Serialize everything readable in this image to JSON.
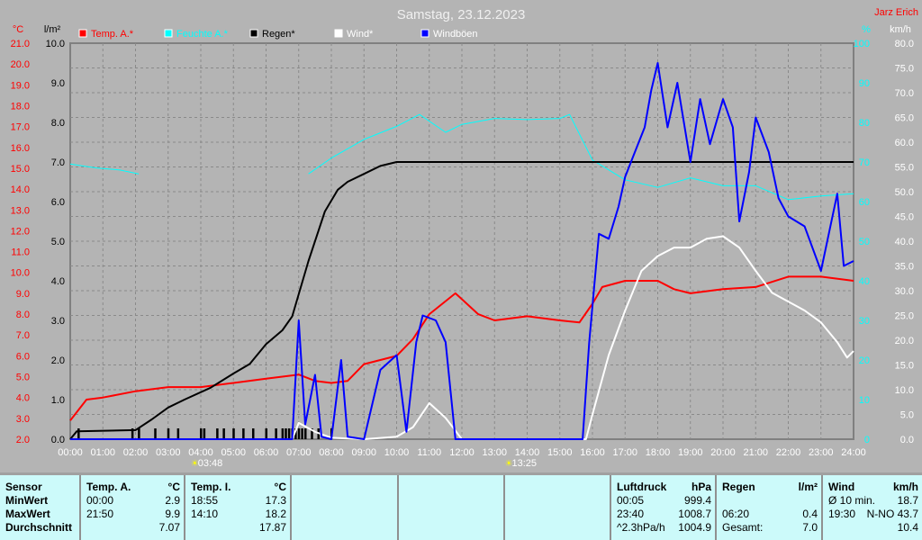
{
  "title": "Samstag, 23.12.2023",
  "author": "Jarz Erich",
  "units": {
    "temp": "°C",
    "rain": "l/m²",
    "hum": "%",
    "wind": "km/h"
  },
  "chart_data": {
    "type": "line",
    "title": "Samstag, 23.12.2023",
    "x_ticks": [
      "00:00",
      "01:00",
      "02:00",
      "03:00",
      "04:00",
      "05:00",
      "06:00",
      "07:00",
      "08:00",
      "09:00",
      "10:00",
      "11:00",
      "12:00",
      "13:00",
      "14:00",
      "15:00",
      "16:00",
      "17:00",
      "18:00",
      "19:00",
      "20:00",
      "21:00",
      "22:00",
      "23:00",
      "24:00"
    ],
    "axes": {
      "temp": {
        "label": "°C",
        "range": [
          2,
          21
        ],
        "ticks": [
          "21.0",
          "20.0",
          "19.0",
          "18.0",
          "17.0",
          "16.0",
          "15.0",
          "14.0",
          "13.0",
          "12.0",
          "11.0",
          "10.0",
          "9.0",
          "8.0",
          "7.0",
          "6.0",
          "5.0",
          "4.0",
          "3.0",
          "2.0"
        ],
        "color": "#ff0000"
      },
      "rain": {
        "label": "l/m²",
        "range": [
          0,
          10
        ],
        "ticks": [
          "10.0",
          "9.0",
          "8.0",
          "7.0",
          "6.0",
          "5.0",
          "4.0",
          "3.0",
          "2.0",
          "1.0",
          "0.0"
        ],
        "color": "#000000"
      },
      "hum": {
        "label": "%",
        "range": [
          0,
          100
        ],
        "ticks": [
          "100",
          "90",
          "80",
          "70",
          "60",
          "50",
          "40",
          "30",
          "20",
          "10",
          "0"
        ],
        "color": "#00ffff"
      },
      "wind": {
        "label": "km/h",
        "range": [
          0,
          80
        ],
        "ticks": [
          "80.0",
          "75.0",
          "70.0",
          "65.0",
          "60.0",
          "55.0",
          "50.0",
          "45.0",
          "40.0",
          "35.0",
          "30.0",
          "25.0",
          "20.0",
          "15.0",
          "10.0",
          "5.0",
          "0.0"
        ],
        "color": "#ffffff"
      }
    },
    "sun_events": [
      {
        "label": "03:48",
        "hour": 3.8
      },
      {
        "label": "13:25",
        "hour": 13.42
      }
    ],
    "legend": [
      {
        "name": "Temp. A.*",
        "color": "#ff0000"
      },
      {
        "name": "Feuchte A.*",
        "color": "#00ffff"
      },
      {
        "name": "Regen*",
        "color": "#000000"
      },
      {
        "name": "Wind*",
        "color": "#ffffff"
      },
      {
        "name": "Windböen",
        "color": "#0000ff"
      }
    ],
    "series": [
      {
        "name": "Temp. A.*",
        "axis": "temp",
        "color": "#ff0000",
        "points": [
          [
            0,
            2.9
          ],
          [
            0.5,
            3.9
          ],
          [
            1,
            4.0
          ],
          [
            2,
            4.3
          ],
          [
            3,
            4.5
          ],
          [
            4,
            4.5
          ],
          [
            5,
            4.7
          ],
          [
            6,
            4.9
          ],
          [
            7,
            5.1
          ],
          [
            7.5,
            4.8
          ],
          [
            8,
            4.7
          ],
          [
            8.5,
            4.8
          ],
          [
            9,
            5.6
          ],
          [
            10,
            6.0
          ],
          [
            10.5,
            6.8
          ],
          [
            11,
            8.0
          ],
          [
            11.8,
            9.0
          ],
          [
            12.5,
            8.0
          ],
          [
            13,
            7.7
          ],
          [
            14,
            7.9
          ],
          [
            15,
            7.7
          ],
          [
            15.6,
            7.6
          ],
          [
            16,
            8.5
          ],
          [
            16.3,
            9.3
          ],
          [
            17,
            9.6
          ],
          [
            18,
            9.6
          ],
          [
            18.5,
            9.2
          ],
          [
            19,
            9.0
          ],
          [
            20,
            9.2
          ],
          [
            21,
            9.3
          ],
          [
            22,
            9.8
          ],
          [
            23,
            9.8
          ],
          [
            24,
            9.6
          ]
        ]
      },
      {
        "name": "Feuchte A.*",
        "axis": "hum",
        "color": "#00ffff",
        "segments": [
          [
            [
              0,
              69.5
            ],
            [
              0.8,
              68.5
            ],
            [
              1.5,
              68
            ],
            [
              2.1,
              67
            ]
          ],
          [
            [
              7.3,
              67
            ],
            [
              8,
              71
            ],
            [
              9,
              75.7
            ],
            [
              10,
              79
            ],
            [
              10.7,
              82
            ],
            [
              11.5,
              77.5
            ],
            [
              12,
              79.5
            ],
            [
              13,
              81
            ],
            [
              14,
              80.7
            ],
            [
              15,
              81
            ],
            [
              15.3,
              82
            ],
            [
              16,
              70.5
            ],
            [
              17,
              65.5
            ],
            [
              18,
              63.6
            ],
            [
              19,
              66
            ],
            [
              20,
              64
            ],
            [
              21,
              64
            ],
            [
              22,
              60.5
            ],
            [
              23,
              61.4
            ],
            [
              24,
              62
            ]
          ]
        ]
      },
      {
        "name": "Regen*",
        "axis": "rain",
        "color": "#000000",
        "points": [
          [
            0,
            0
          ],
          [
            0.2,
            0.2
          ],
          [
            2,
            0.23
          ],
          [
            2.5,
            0.5
          ],
          [
            3,
            0.8
          ],
          [
            3.5,
            1.0
          ],
          [
            4.3,
            1.3
          ],
          [
            5,
            1.66
          ],
          [
            5.5,
            1.9
          ],
          [
            6,
            2.4
          ],
          [
            6.5,
            2.75
          ],
          [
            6.8,
            3.1
          ],
          [
            7.3,
            4.5
          ],
          [
            7.8,
            5.75
          ],
          [
            8.2,
            6.3
          ],
          [
            8.5,
            6.5
          ],
          [
            9,
            6.7
          ],
          [
            9.5,
            6.9
          ],
          [
            10,
            7.0
          ],
          [
            24,
            7.0
          ]
        ],
        "bars": [
          0.25,
          1.9,
          2.1,
          2.6,
          3.0,
          3.3,
          4.0,
          4.1,
          4.5,
          4.7,
          5.0,
          5.3,
          5.6,
          6.0,
          6.3,
          6.5,
          6.6,
          6.7,
          6.8,
          6.9,
          7.0,
          7.1,
          7.2,
          7.4,
          7.6,
          8.0
        ]
      },
      {
        "name": "Wind*",
        "axis": "wind",
        "color": "#ffffff",
        "points": [
          [
            0,
            0
          ],
          [
            6.8,
            0
          ],
          [
            7,
            3.3
          ],
          [
            7.5,
            1.5
          ],
          [
            8,
            0.3
          ],
          [
            9,
            0
          ],
          [
            10,
            0.5
          ],
          [
            10.5,
            2.4
          ],
          [
            11,
            7.3
          ],
          [
            11.5,
            4.3
          ],
          [
            12,
            0
          ],
          [
            15.8,
            0
          ],
          [
            16,
            5
          ],
          [
            16.5,
            17
          ],
          [
            17,
            26
          ],
          [
            17.5,
            34
          ],
          [
            18,
            37
          ],
          [
            18.5,
            38.7
          ],
          [
            19,
            38.7
          ],
          [
            19.5,
            40.5
          ],
          [
            20,
            41
          ],
          [
            20.5,
            38.7
          ],
          [
            21,
            34
          ],
          [
            21.5,
            29.6
          ],
          [
            22,
            27.8
          ],
          [
            22.5,
            26
          ],
          [
            23,
            23.6
          ],
          [
            23.5,
            19.6
          ],
          [
            23.8,
            16.5
          ],
          [
            24,
            17.8
          ]
        ]
      },
      {
        "name": "Windböen",
        "axis": "wind",
        "color": "#0000ff",
        "points": [
          [
            0,
            0
          ],
          [
            6.8,
            0
          ],
          [
            7,
            24
          ],
          [
            7.2,
            3
          ],
          [
            7.5,
            13
          ],
          [
            7.7,
            0.5
          ],
          [
            8,
            0
          ],
          [
            8.3,
            16
          ],
          [
            8.5,
            0.5
          ],
          [
            9,
            0
          ],
          [
            9.5,
            14
          ],
          [
            10,
            17
          ],
          [
            10.3,
            1.5
          ],
          [
            10.6,
            19.6
          ],
          [
            10.8,
            25
          ],
          [
            11.2,
            24
          ],
          [
            11.5,
            19.6
          ],
          [
            11.8,
            0
          ],
          [
            15.7,
            0
          ],
          [
            15.9,
            19.6
          ],
          [
            16.2,
            41.5
          ],
          [
            16.5,
            40.5
          ],
          [
            16.8,
            47
          ],
          [
            17,
            53
          ],
          [
            17.3,
            58
          ],
          [
            17.6,
            63
          ],
          [
            17.8,
            70.5
          ],
          [
            18,
            76
          ],
          [
            18.3,
            63
          ],
          [
            18.6,
            72
          ],
          [
            19,
            56
          ],
          [
            19.3,
            68.7
          ],
          [
            19.6,
            59.6
          ],
          [
            20,
            68.7
          ],
          [
            20.3,
            63
          ],
          [
            20.5,
            44
          ],
          [
            20.8,
            54
          ],
          [
            21,
            65
          ],
          [
            21.4,
            58
          ],
          [
            21.7,
            48.7
          ],
          [
            22,
            45
          ],
          [
            22.5,
            43
          ],
          [
            23,
            34
          ],
          [
            23.5,
            49.6
          ],
          [
            23.7,
            35
          ],
          [
            24,
            36
          ]
        ]
      }
    ]
  },
  "table": {
    "sensor": {
      "header": "Sensor",
      "rows": [
        "MinWert",
        "MaxWert",
        "Durchschnitt"
      ]
    },
    "temp_a": {
      "header": "Temp. A.",
      "unit": "°C",
      "rows": [
        [
          "00:00",
          "2.9"
        ],
        [
          "21:50",
          "9.9"
        ],
        [
          "",
          "7.07"
        ]
      ]
    },
    "temp_i": {
      "header": "Temp. I.",
      "unit": "°C",
      "rows": [
        [
          "18:55",
          "17.3"
        ],
        [
          "14:10",
          "18.2"
        ],
        [
          "",
          "17.87"
        ]
      ]
    },
    "pressure": {
      "header": "Luftdruck",
      "unit": "hPa",
      "rows": [
        [
          "00:05",
          "999.4"
        ],
        [
          "23:40",
          "1008.7"
        ],
        [
          "^2.3hPa/h",
          "1004.9"
        ]
      ]
    },
    "rain": {
      "header": "Regen",
      "unit": "l/m²",
      "rows": [
        [
          "",
          ""
        ],
        [
          "06:20",
          "0.4"
        ],
        [
          "Gesamt:",
          "7.0"
        ]
      ]
    },
    "wind": {
      "header": "Wind",
      "unit": "km/h",
      "rows": [
        [
          "Ø 10 min.",
          "18.7"
        ],
        [
          "19:30",
          "N-NO 43.7"
        ],
        [
          "",
          "10.4"
        ]
      ]
    }
  }
}
